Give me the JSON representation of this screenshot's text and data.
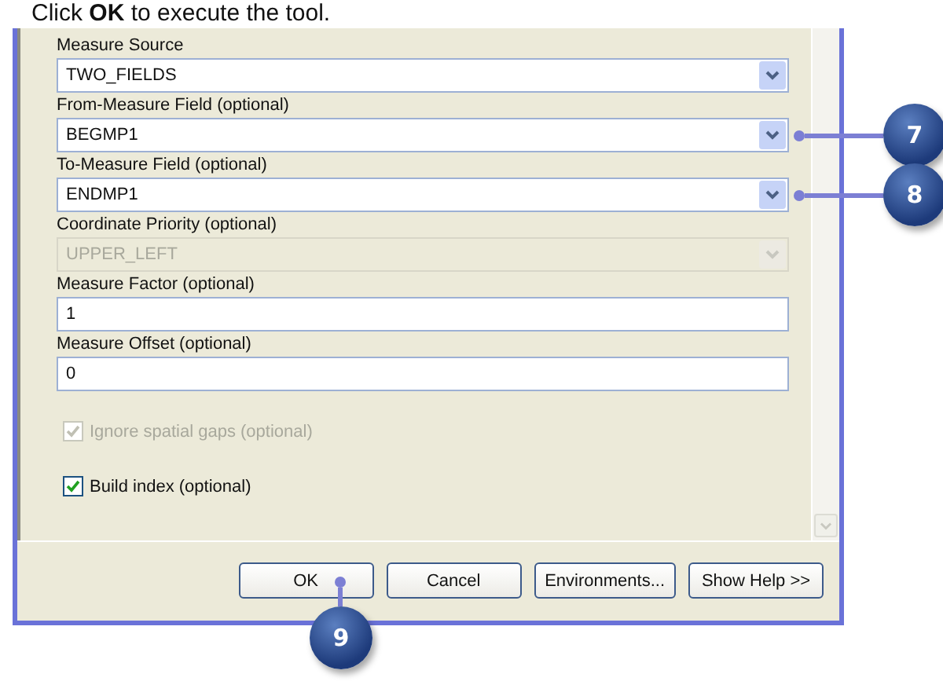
{
  "instruction": "Click **OK** to execute the tool.",
  "fields": [
    {
      "label": "Measure Source",
      "kind": "dropdown",
      "value": "TWO_FIELDS",
      "disabled": false
    },
    {
      "label": "From-Measure Field (optional)",
      "kind": "dropdown",
      "value": "BEGMP1",
      "disabled": false,
      "callout": "7"
    },
    {
      "label": "To-Measure Field (optional)",
      "kind": "dropdown",
      "value": "ENDMP1",
      "disabled": false,
      "callout": "8"
    },
    {
      "label": "Coordinate Priority (optional)",
      "kind": "dropdown",
      "value": "UPPER_LEFT",
      "disabled": true
    },
    {
      "label": "Measure Factor (optional)",
      "kind": "text",
      "value": "1",
      "disabled": false
    },
    {
      "label": "Measure Offset (optional)",
      "kind": "text",
      "value": "0",
      "disabled": false
    }
  ],
  "checkboxes": [
    {
      "label": "Ignore spatial gaps (optional)",
      "checked": true,
      "disabled": true
    },
    {
      "label": "Build index (optional)",
      "checked": true,
      "disabled": false
    }
  ],
  "buttons": [
    {
      "label": "OK",
      "callout": "9"
    },
    {
      "label": "Cancel"
    },
    {
      "label": "Environments..."
    },
    {
      "label": "Show Help >>"
    }
  ]
}
